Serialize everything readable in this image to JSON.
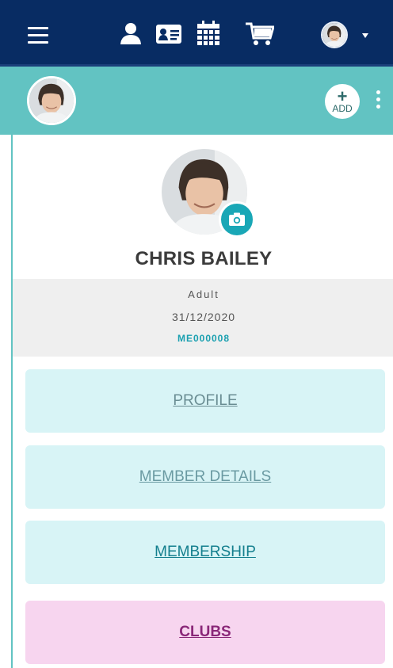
{
  "topbar": {
    "icons": [
      "menu-icon",
      "user-icon",
      "id-card-icon",
      "calendar-icon",
      "cart-icon",
      "avatar",
      "caret-down-icon"
    ],
    "colors": {
      "background": "#082c63",
      "icon": "#ffffff"
    }
  },
  "subbar": {
    "add_label": "ADD",
    "add_plus": "+",
    "colors": {
      "background": "#62c3c2"
    }
  },
  "profile": {
    "name": "CHRIS BAILEY",
    "member_type": "Adult",
    "date": "31/12/2020",
    "member_id": "ME000008"
  },
  "menu": {
    "items": [
      {
        "label": "PROFILE"
      },
      {
        "label": "MEMBER DETAILS"
      },
      {
        "label": "MEMBERSHIP"
      },
      {
        "label": "CLUBS"
      }
    ],
    "colors": {
      "teal_card": "#d8f4f6",
      "pink_card": "#f7d5ef",
      "clubs_text": "#8a2778"
    }
  }
}
